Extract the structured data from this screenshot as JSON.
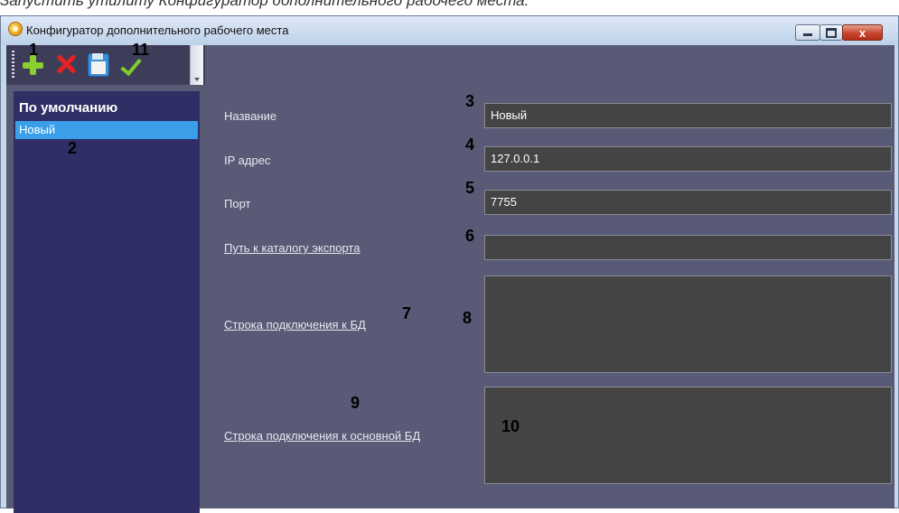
{
  "caption": "Запустить утилиту Конфигуратор дополнительного рабочего места.",
  "window": {
    "title": "Конфигуратор дополнительного рабочего места",
    "close_glyph": "x"
  },
  "toolbar": {
    "icons": [
      "add-icon",
      "delete-icon",
      "save-icon",
      "apply-checkmark-icon"
    ]
  },
  "sidebar": {
    "header": "По умолчанию",
    "items": [
      {
        "label": "Новый",
        "selected": true
      }
    ],
    "selected_color": "#3a9ee8"
  },
  "form": {
    "name_label": "Название",
    "name_value": "Новый",
    "ip_label": "IP адрес",
    "ip_value": "127.0.0.1",
    "port_label": "Порт",
    "port_value": "7755",
    "export_label": "Путь к каталогу экспорта",
    "export_value": "",
    "db_label": "Строка подключения к БД",
    "db_value": "",
    "main_db_label": "Строка подключения к основной БД",
    "main_db_value": ""
  },
  "callouts": {
    "n1": "1",
    "n2": "2",
    "n3": "3",
    "n4": "4",
    "n5": "5",
    "n6": "6",
    "n7": "7",
    "n8": "8",
    "n9": "9",
    "n10": "10",
    "n11": "11"
  },
  "colors": {
    "background": "#595a75",
    "sidebar": "#2f2f65",
    "input_bg": "#444444",
    "toolbar": "#3d3d5a"
  }
}
